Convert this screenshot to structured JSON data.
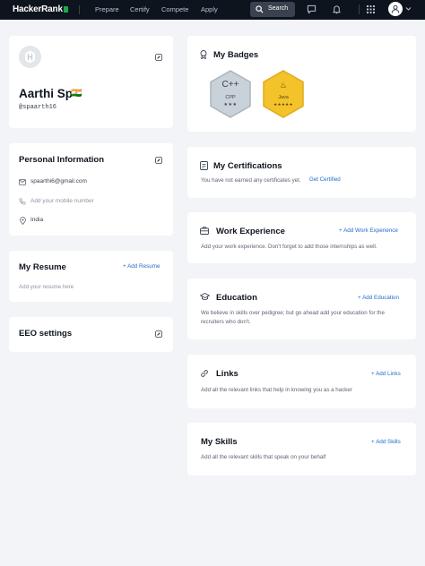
{
  "header": {
    "logo": "HackerRank",
    "nav": [
      "Prepare",
      "Certify",
      "Compete",
      "Apply"
    ],
    "search_label": "Search"
  },
  "profile": {
    "name": "Aarthi Sp",
    "flag": "🇮🇳",
    "username": "@spaarth16"
  },
  "personal": {
    "title": "Personal Information",
    "email": "spaarthi6@gmail.com",
    "phone_placeholder": "Add your mobile number",
    "country": "India"
  },
  "resume": {
    "title": "My Resume",
    "action": "+ Add Resume",
    "placeholder": "Add your resume here"
  },
  "eeo": {
    "title": "EEO settings"
  },
  "badges": {
    "title": "My Badges",
    "items": [
      {
        "symbol": "C++",
        "name": "CPP",
        "stars": "★★★",
        "color": "#c9d2d9"
      },
      {
        "symbol": "♨",
        "name": "Java",
        "stars": "★★★★★",
        "color": "#f4c22b"
      }
    ]
  },
  "certifications": {
    "title": "My Certifications",
    "text": "You have not earned any certificates yet.",
    "action": "Get Certified"
  },
  "work": {
    "title": "Work Experience",
    "action": "+ Add Work Experience",
    "text": "Add your work experience. Don't forget to add those internships as well."
  },
  "education": {
    "title": "Education",
    "action": "+ Add Education",
    "text": "We believe in skills over pedigree; but go ahead add your education for the recruiters who don't."
  },
  "links": {
    "title": "Links",
    "action": "+ Add Links",
    "text": "Add all the relevant links that help in knowing you as a hacker"
  },
  "skills": {
    "title": "My Skills",
    "action": "+ Add Skills",
    "text": "Add all the relevant skills that speak on your behalf"
  }
}
